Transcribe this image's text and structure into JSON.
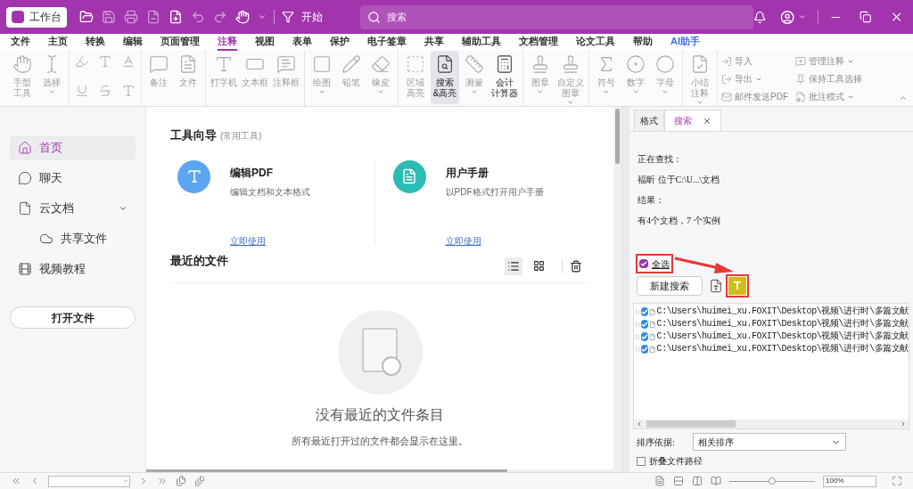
{
  "titlebar": {
    "home_button": "工作台",
    "start_button": "开始",
    "search": {
      "placeholder": "搜索"
    }
  },
  "menu_tabs": [
    {
      "label": "文件",
      "kind": "menu",
      "selected": false
    },
    {
      "label": "主页",
      "kind": "menu",
      "selected": false
    },
    {
      "label": "转换",
      "kind": "menu",
      "selected": false
    },
    {
      "label": "编辑",
      "kind": "menu",
      "selected": false
    },
    {
      "label": "页面管理",
      "kind": "menu",
      "selected": false
    },
    {
      "label": "注释",
      "kind": "menu",
      "selected": true
    },
    {
      "label": "视图",
      "kind": "menu",
      "selected": false
    },
    {
      "label": "表单",
      "kind": "menu",
      "selected": false
    },
    {
      "label": "保护",
      "kind": "menu",
      "selected": false
    },
    {
      "label": "电子签章",
      "kind": "menu",
      "selected": false
    },
    {
      "label": "共享",
      "kind": "menu",
      "selected": false
    },
    {
      "label": "辅助工具",
      "kind": "menu",
      "selected": false
    },
    {
      "label": "文档管理",
      "kind": "menu",
      "selected": false
    },
    {
      "label": "论文工具",
      "kind": "menu",
      "selected": false
    },
    {
      "label": "帮助",
      "kind": "menu",
      "selected": false
    },
    {
      "label": "AI助手",
      "kind": "ai",
      "selected": false
    }
  ],
  "ribbon": {
    "groups": [
      {
        "tools": [
          {
            "lines": [
              "手型",
              "工具"
            ],
            "dropdown": false,
            "disabled": true,
            "selected": false
          },
          {
            "lines": [
              "选择"
            ],
            "dropdown": true,
            "disabled": true,
            "selected": false
          }
        ]
      },
      {
        "tools": [
          {
            "lines": [
              "备注"
            ],
            "dropdown": false,
            "disabled": true,
            "selected": false
          },
          {
            "lines": [
              "文件"
            ],
            "dropdown": false,
            "disabled": true,
            "selected": false
          }
        ]
      },
      {
        "tools": [
          {
            "lines": [
              "打字机"
            ],
            "dropdown": false,
            "disabled": true,
            "selected": false
          },
          {
            "lines": [
              "文本框"
            ],
            "dropdown": false,
            "disabled": true,
            "selected": false
          },
          {
            "lines": [
              "注释框"
            ],
            "dropdown": false,
            "disabled": true,
            "selected": false
          }
        ]
      },
      {
        "tools": [
          {
            "lines": [
              "绘图"
            ],
            "dropdown": true,
            "disabled": true,
            "selected": false
          },
          {
            "lines": [
              "铅笔"
            ],
            "dropdown": false,
            "disabled": true,
            "selected": false
          },
          {
            "lines": [
              "橡皮"
            ],
            "dropdown": true,
            "disabled": true,
            "selected": false
          }
        ]
      },
      {
        "tools": [
          {
            "lines": [
              "区域",
              "高亮"
            ],
            "dropdown": false,
            "disabled": true,
            "selected": false
          },
          {
            "lines": [
              "搜索",
              "&高亮"
            ],
            "dropdown": false,
            "disabled": false,
            "selected": true
          },
          {
            "lines": [
              "测量"
            ],
            "dropdown": true,
            "disabled": true,
            "selected": false
          },
          {
            "lines": [
              "会计",
              "计算器"
            ],
            "dropdown": false,
            "disabled": false,
            "selected": false
          }
        ]
      },
      {
        "tools": [
          {
            "lines": [
              "图章"
            ],
            "dropdown": true,
            "disabled": true,
            "selected": false
          },
          {
            "lines": [
              "自定义",
              "图章"
            ],
            "dropdown": true,
            "disabled": true,
            "selected": false
          }
        ]
      },
      {
        "tools": [
          {
            "lines": [
              "符号"
            ],
            "dropdown": true,
            "disabled": true,
            "selected": false
          },
          {
            "lines": [
              "数字"
            ],
            "dropdown": true,
            "disabled": true,
            "selected": false
          },
          {
            "lines": [
              "字母"
            ],
            "dropdown": true,
            "disabled": true,
            "selected": false
          }
        ]
      },
      {
        "tools": [
          {
            "lines": [
              "小结",
              "注释"
            ],
            "dropdown": true,
            "disabled": true,
            "selected": false
          }
        ]
      }
    ],
    "small_tools": [
      {
        "label": "导入",
        "dropdown": false
      },
      {
        "label": "导出",
        "dropdown": true
      },
      {
        "label": "邮件发送PDF",
        "dropdown": false
      },
      {
        "label": "管理注释",
        "dropdown": true
      },
      {
        "label": "保持工具选择",
        "dropdown": false
      },
      {
        "label": "批注模式",
        "dropdown": true
      }
    ]
  },
  "sidebar": {
    "items": [
      {
        "label": "首页",
        "selected": true
      },
      {
        "label": "聊天",
        "selected": false
      },
      {
        "label": "云文档",
        "selected": false,
        "expanded": true,
        "children": [
          {
            "label": "共享文件",
            "selected": false
          }
        ]
      },
      {
        "label": "视频教程",
        "selected": false
      }
    ],
    "open_button": "打开文件"
  },
  "tool_guide": {
    "title": "工具向导",
    "subtitle": "(常用工具)",
    "cards": [
      {
        "title": "编辑PDF",
        "description": "编辑文档和文本格式",
        "link": "立即使用",
        "color": "#5aa6f0"
      },
      {
        "title": "用户手册",
        "description": "以PDF格式打开用户手册",
        "link": "立即使用",
        "color": "#2bbcb4"
      }
    ]
  },
  "recent_files": {
    "title": "最近的文件",
    "views": [
      {
        "kind": "list",
        "selected": true
      },
      {
        "kind": "grid",
        "selected": false
      }
    ],
    "empty_title": "没有最近的文件条目",
    "empty_text": "所有最近打开过的文件都会显示在这里。"
  },
  "search_panel": {
    "tabs": [
      {
        "label": "格式",
        "selected": false,
        "closable": false
      },
      {
        "label": "搜索",
        "selected": true,
        "closable": true
      }
    ],
    "info": [
      "正在查找：",
      "福昕 位于C:\\U...\\文档",
      "结果：",
      "有4个文档，7 个实例"
    ],
    "select_all": {
      "label": "全选",
      "checked": true
    },
    "new_search_button": "新建搜索",
    "highlight_button": "T",
    "results": [
      {
        "path": "C:\\Users\\huimei_xu.FOXIT\\Desktop\\视频\\进行时\\多篇文献",
        "checked": true,
        "expanded": false
      },
      {
        "path": "C:\\Users\\huimei_xu.FOXIT\\Desktop\\视频\\进行时\\多篇文献",
        "checked": true,
        "expanded": false
      },
      {
        "path": "C:\\Users\\huimei_xu.FOXIT\\Desktop\\视频\\进行时\\多篇文献",
        "checked": true,
        "expanded": false
      },
      {
        "path": "C:\\Users\\huimei_xu.FOXIT\\Desktop\\视频\\进行时\\多篇文献",
        "checked": true,
        "expanded": false
      }
    ],
    "sort_label": "排序依据:",
    "sort_value": "相关排序",
    "collapse_paths": {
      "label": "折叠文件路径",
      "checked": false
    }
  },
  "status_bar": {
    "zoom_value": "100%",
    "zoom": {
      "level": 0.5
    }
  }
}
